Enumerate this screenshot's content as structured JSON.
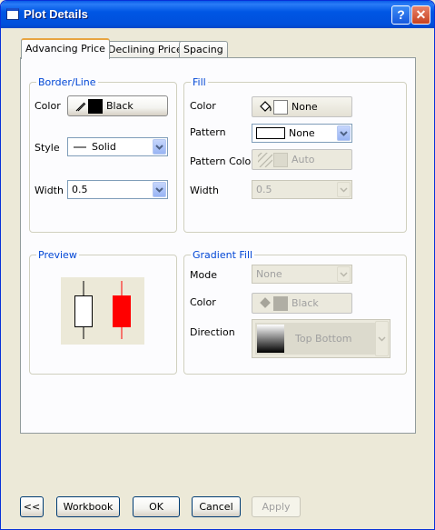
{
  "window": {
    "title": "Plot Details"
  },
  "tabs": [
    {
      "label": "Advancing Price",
      "active": true
    },
    {
      "label": "Declining Price",
      "active": false
    },
    {
      "label": "Spacing",
      "active": false
    }
  ],
  "border_line": {
    "title": "Border/Line",
    "color_label": "Color",
    "color_value": "Black",
    "color_hex": "#000000",
    "style_label": "Style",
    "style_value": "Solid",
    "width_label": "Width",
    "width_value": "0.5"
  },
  "fill": {
    "title": "Fill",
    "color_label": "Color",
    "color_value": "None",
    "pattern_label": "Pattern",
    "pattern_value": "None",
    "pattern_color_label": "Pattern Color",
    "pattern_color_value": "Auto",
    "width_label": "Width",
    "width_value": "0.5"
  },
  "preview": {
    "title": "Preview",
    "up_color": "#ffffff",
    "down_color": "#ff0000"
  },
  "gradient_fill": {
    "title": "Gradient Fill",
    "mode_label": "Mode",
    "mode_value": "None",
    "color_label": "Color",
    "color_value": "Black",
    "direction_label": "Direction",
    "direction_value": "Top Bottom"
  },
  "footer": {
    "collapse_label": "<<",
    "workbook_label": "Workbook",
    "ok_label": "OK",
    "cancel_label": "Cancel",
    "apply_label": "Apply"
  },
  "icons": [
    "window-icon",
    "help-icon",
    "close-icon",
    "pen-icon",
    "paint-bucket-icon",
    "hatch-pattern-icon",
    "chevron-down-icon"
  ]
}
